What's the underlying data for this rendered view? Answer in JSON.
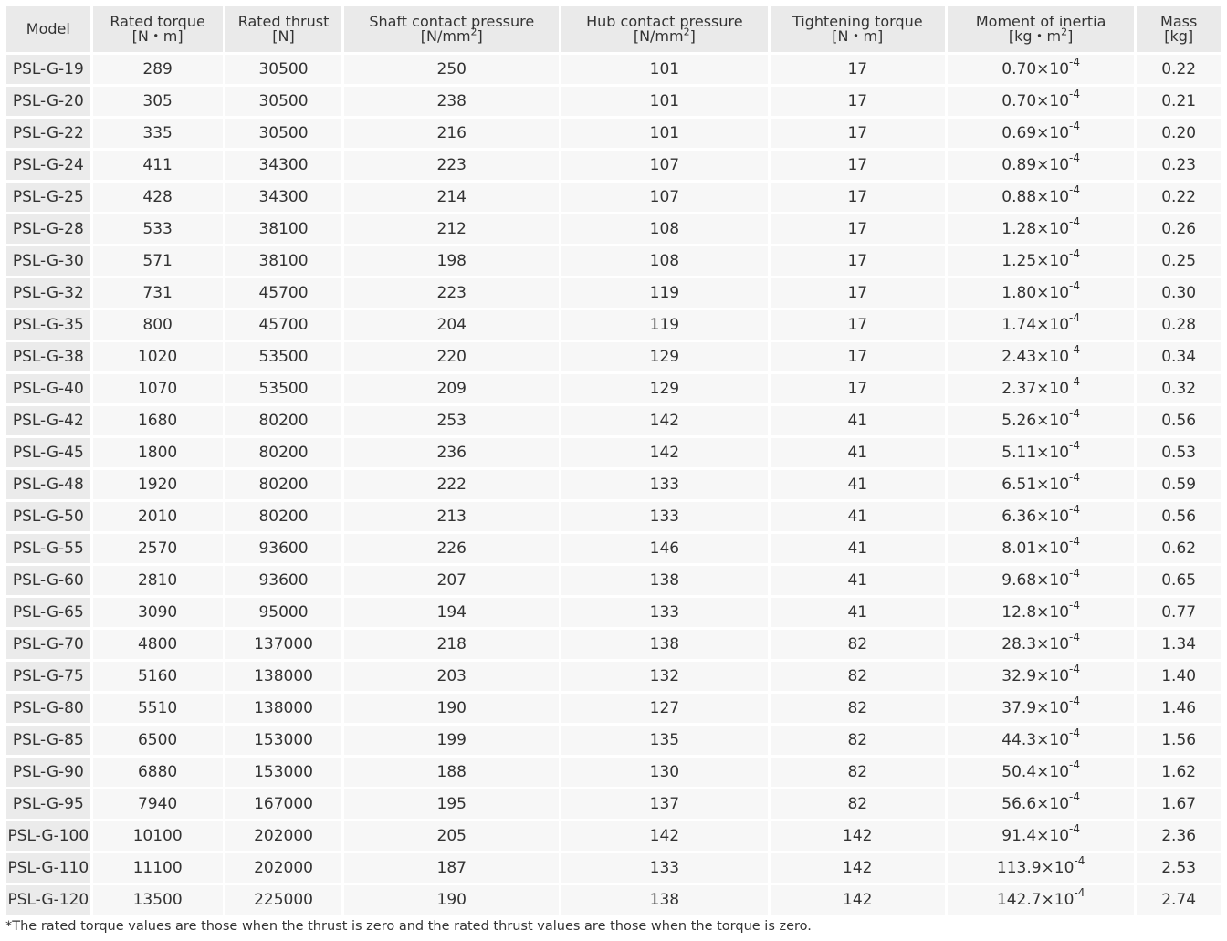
{
  "table": {
    "headers": [
      {
        "line1": "Model",
        "line2": "",
        "sup": "",
        "after": ""
      },
      {
        "line1": "Rated torque",
        "line2": "[N・m]",
        "sup": "",
        "after": ""
      },
      {
        "line1": "Rated thrust",
        "line2": "[N]",
        "sup": "",
        "after": ""
      },
      {
        "line1": "Shaft contact pressure",
        "line2": "[N/mm",
        "sup": "2",
        "after": "]"
      },
      {
        "line1": "Hub contact pressure",
        "line2": "[N/mm",
        "sup": "2",
        "after": "]"
      },
      {
        "line1": "Tightening torque",
        "line2": "[N・m]",
        "sup": "",
        "after": ""
      },
      {
        "line1": "Moment of inertia",
        "line2": "[kg・m",
        "sup": "2",
        "after": "]"
      },
      {
        "line1": "Mass",
        "line2": "[kg]",
        "sup": "",
        "after": ""
      }
    ],
    "inertia_exponent": "-4",
    "rows": [
      {
        "model": "PSL-G-19",
        "rated_torque": "289",
        "rated_thrust": "30500",
        "shaft_pressure": "250",
        "hub_pressure": "101",
        "tightening_torque": "17",
        "inertia_mantissa": "0.70×10",
        "mass": "0.22"
      },
      {
        "model": "PSL-G-20",
        "rated_torque": "305",
        "rated_thrust": "30500",
        "shaft_pressure": "238",
        "hub_pressure": "101",
        "tightening_torque": "17",
        "inertia_mantissa": "0.70×10",
        "mass": "0.21"
      },
      {
        "model": "PSL-G-22",
        "rated_torque": "335",
        "rated_thrust": "30500",
        "shaft_pressure": "216",
        "hub_pressure": "101",
        "tightening_torque": "17",
        "inertia_mantissa": "0.69×10",
        "mass": "0.20"
      },
      {
        "model": "PSL-G-24",
        "rated_torque": "411",
        "rated_thrust": "34300",
        "shaft_pressure": "223",
        "hub_pressure": "107",
        "tightening_torque": "17",
        "inertia_mantissa": "0.89×10",
        "mass": "0.23"
      },
      {
        "model": "PSL-G-25",
        "rated_torque": "428",
        "rated_thrust": "34300",
        "shaft_pressure": "214",
        "hub_pressure": "107",
        "tightening_torque": "17",
        "inertia_mantissa": "0.88×10",
        "mass": "0.22"
      },
      {
        "model": "PSL-G-28",
        "rated_torque": "533",
        "rated_thrust": "38100",
        "shaft_pressure": "212",
        "hub_pressure": "108",
        "tightening_torque": "17",
        "inertia_mantissa": "1.28×10",
        "mass": "0.26"
      },
      {
        "model": "PSL-G-30",
        "rated_torque": "571",
        "rated_thrust": "38100",
        "shaft_pressure": "198",
        "hub_pressure": "108",
        "tightening_torque": "17",
        "inertia_mantissa": "1.25×10",
        "mass": "0.25"
      },
      {
        "model": "PSL-G-32",
        "rated_torque": "731",
        "rated_thrust": "45700",
        "shaft_pressure": "223",
        "hub_pressure": "119",
        "tightening_torque": "17",
        "inertia_mantissa": "1.80×10",
        "mass": "0.30"
      },
      {
        "model": "PSL-G-35",
        "rated_torque": "800",
        "rated_thrust": "45700",
        "shaft_pressure": "204",
        "hub_pressure": "119",
        "tightening_torque": "17",
        "inertia_mantissa": "1.74×10",
        "mass": "0.28"
      },
      {
        "model": "PSL-G-38",
        "rated_torque": "1020",
        "rated_thrust": "53500",
        "shaft_pressure": "220",
        "hub_pressure": "129",
        "tightening_torque": "17",
        "inertia_mantissa": "2.43×10",
        "mass": "0.34"
      },
      {
        "model": "PSL-G-40",
        "rated_torque": "1070",
        "rated_thrust": "53500",
        "shaft_pressure": "209",
        "hub_pressure": "129",
        "tightening_torque": "17",
        "inertia_mantissa": "2.37×10",
        "mass": "0.32"
      },
      {
        "model": "PSL-G-42",
        "rated_torque": "1680",
        "rated_thrust": "80200",
        "shaft_pressure": "253",
        "hub_pressure": "142",
        "tightening_torque": "41",
        "inertia_mantissa": "5.26×10",
        "mass": "0.56"
      },
      {
        "model": "PSL-G-45",
        "rated_torque": "1800",
        "rated_thrust": "80200",
        "shaft_pressure": "236",
        "hub_pressure": "142",
        "tightening_torque": "41",
        "inertia_mantissa": "5.11×10",
        "mass": "0.53"
      },
      {
        "model": "PSL-G-48",
        "rated_torque": "1920",
        "rated_thrust": "80200",
        "shaft_pressure": "222",
        "hub_pressure": "133",
        "tightening_torque": "41",
        "inertia_mantissa": "6.51×10",
        "mass": "0.59"
      },
      {
        "model": "PSL-G-50",
        "rated_torque": "2010",
        "rated_thrust": "80200",
        "shaft_pressure": "213",
        "hub_pressure": "133",
        "tightening_torque": "41",
        "inertia_mantissa": "6.36×10",
        "mass": "0.56"
      },
      {
        "model": "PSL-G-55",
        "rated_torque": "2570",
        "rated_thrust": "93600",
        "shaft_pressure": "226",
        "hub_pressure": "146",
        "tightening_torque": "41",
        "inertia_mantissa": "8.01×10",
        "mass": "0.62"
      },
      {
        "model": "PSL-G-60",
        "rated_torque": "2810",
        "rated_thrust": "93600",
        "shaft_pressure": "207",
        "hub_pressure": "138",
        "tightening_torque": "41",
        "inertia_mantissa": "9.68×10",
        "mass": "0.65"
      },
      {
        "model": "PSL-G-65",
        "rated_torque": "3090",
        "rated_thrust": "95000",
        "shaft_pressure": "194",
        "hub_pressure": "133",
        "tightening_torque": "41",
        "inertia_mantissa": "12.8×10",
        "mass": "0.77"
      },
      {
        "model": "PSL-G-70",
        "rated_torque": "4800",
        "rated_thrust": "137000",
        "shaft_pressure": "218",
        "hub_pressure": "138",
        "tightening_torque": "82",
        "inertia_mantissa": "28.3×10",
        "mass": "1.34"
      },
      {
        "model": "PSL-G-75",
        "rated_torque": "5160",
        "rated_thrust": "138000",
        "shaft_pressure": "203",
        "hub_pressure": "132",
        "tightening_torque": "82",
        "inertia_mantissa": "32.9×10",
        "mass": "1.40"
      },
      {
        "model": "PSL-G-80",
        "rated_torque": "5510",
        "rated_thrust": "138000",
        "shaft_pressure": "190",
        "hub_pressure": "127",
        "tightening_torque": "82",
        "inertia_mantissa": "37.9×10",
        "mass": "1.46"
      },
      {
        "model": "PSL-G-85",
        "rated_torque": "6500",
        "rated_thrust": "153000",
        "shaft_pressure": "199",
        "hub_pressure": "135",
        "tightening_torque": "82",
        "inertia_mantissa": "44.3×10",
        "mass": "1.56"
      },
      {
        "model": "PSL-G-90",
        "rated_torque": "6880",
        "rated_thrust": "153000",
        "shaft_pressure": "188",
        "hub_pressure": "130",
        "tightening_torque": "82",
        "inertia_mantissa": "50.4×10",
        "mass": "1.62"
      },
      {
        "model": "PSL-G-95",
        "rated_torque": "7940",
        "rated_thrust": "167000",
        "shaft_pressure": "195",
        "hub_pressure": "137",
        "tightening_torque": "82",
        "inertia_mantissa": "56.6×10",
        "mass": "1.67"
      },
      {
        "model": "PSL-G-100",
        "rated_torque": "10100",
        "rated_thrust": "202000",
        "shaft_pressure": "205",
        "hub_pressure": "142",
        "tightening_torque": "142",
        "inertia_mantissa": "91.4×10",
        "mass": "2.36"
      },
      {
        "model": "PSL-G-110",
        "rated_torque": "11100",
        "rated_thrust": "202000",
        "shaft_pressure": "187",
        "hub_pressure": "133",
        "tightening_torque": "142",
        "inertia_mantissa": "113.9×10",
        "mass": "2.53"
      },
      {
        "model": "PSL-G-120",
        "rated_torque": "13500",
        "rated_thrust": "225000",
        "shaft_pressure": "190",
        "hub_pressure": "138",
        "tightening_torque": "142",
        "inertia_mantissa": "142.7×10",
        "mass": "2.74"
      }
    ]
  },
  "footnote": "*The rated torque values are those when the thrust is zero and the rated thrust values are those when the torque is zero.",
  "colors": {
    "header_bg": "#eaeaea",
    "model_cell_bg": "#ebebeb",
    "cell_bg": "#f7f7f7",
    "text": "#333333"
  }
}
